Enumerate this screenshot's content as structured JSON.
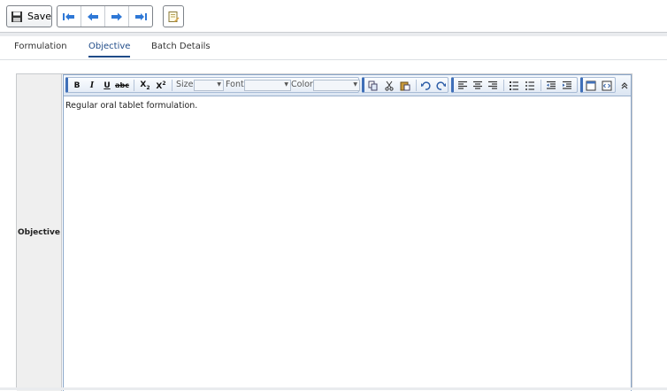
{
  "toolbar": {
    "save_label": "Save"
  },
  "tabs": [
    {
      "label": "Formulation"
    },
    {
      "label": "Objective"
    },
    {
      "label": "Batch Details"
    }
  ],
  "field": {
    "label": "Objective"
  },
  "editor": {
    "size_label": "Size",
    "font_label": "Font",
    "color_label": "Color",
    "content": "Regular oral tablet formulation.",
    "buttons": {
      "bold": "B",
      "italic": "I",
      "underline": "U",
      "strike": "abc",
      "subscript": "X",
      "superscript": "X"
    }
  },
  "colors": {
    "accent": "#1f4b88",
    "toolbar_bg": "#dbe5f2",
    "icon_blue": "#3f6fb8"
  }
}
